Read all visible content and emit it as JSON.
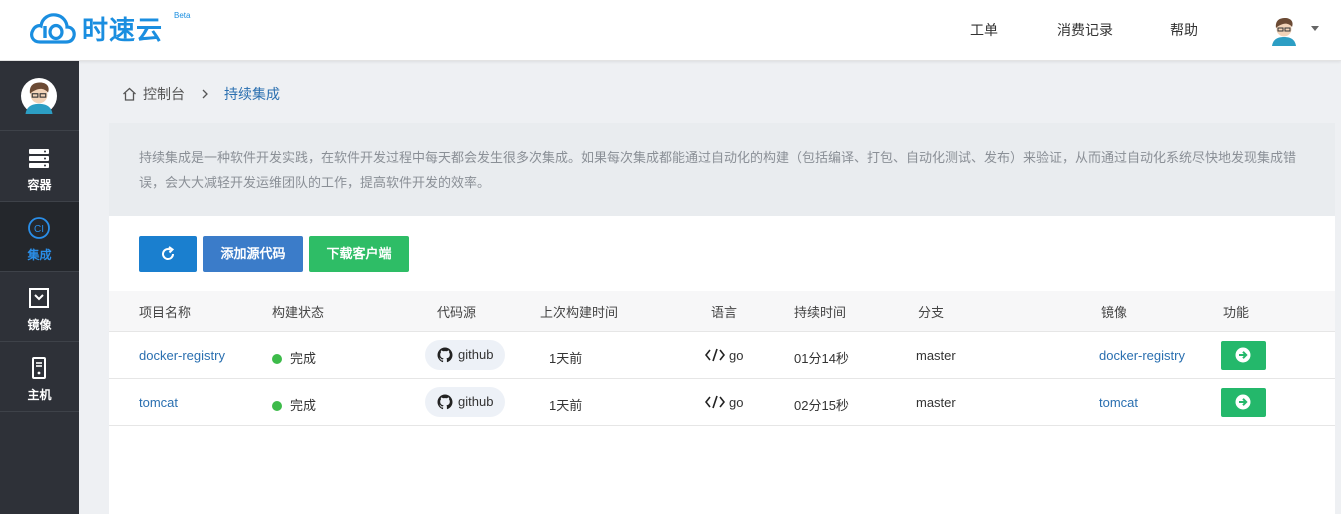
{
  "header": {
    "logo_text": "时速云",
    "logo_badge": "Beta",
    "nav": [
      "工单",
      "消费记录",
      "帮助"
    ]
  },
  "sidebar": {
    "items": [
      {
        "label": "容器",
        "icon": "server-icon"
      },
      {
        "label": "集成",
        "icon": "ci-icon",
        "active": true
      },
      {
        "label": "镜像",
        "icon": "image-box-icon"
      },
      {
        "label": "主机",
        "icon": "host-icon"
      }
    ]
  },
  "breadcrumb": {
    "home": "控制台",
    "current": "持续集成"
  },
  "description": "持续集成是一种软件开发实践，在软件开发过程中每天都会发生很多次集成。如果每次集成都能通过自动化的构建（包括编译、打包、自动化测试、发布）来验证，从而通过自动化系统尽快地发现集成错误，会大大减轻开发运维团队的工作，提高软件开发的效率。",
  "toolbar": {
    "add_source_label": "添加源代码",
    "download_client_label": "下载客户端"
  },
  "table": {
    "columns": [
      "项目名称",
      "构建状态",
      "代码源",
      "上次构建时间",
      "语言",
      "持续时间",
      "分支",
      "镜像",
      "功能"
    ],
    "rows": [
      {
        "name": "docker-registry",
        "status": "完成",
        "source": "github",
        "last_build": "1天前",
        "language": "go",
        "duration": "01分14秒",
        "branch": "master",
        "image": "docker-registry"
      },
      {
        "name": "tomcat",
        "status": "完成",
        "source": "github",
        "last_build": "1天前",
        "language": "go",
        "duration": "02分15秒",
        "branch": "master",
        "image": "tomcat"
      }
    ]
  },
  "colors": {
    "brand_blue": "#1a8ee0",
    "sidebar_bg": "#2e3138",
    "refresh_btn": "#1a7fcf",
    "add_btn": "#3b7cc9",
    "download_btn": "#2ebd66",
    "status_green": "#3dbb4a",
    "link": "#2a6fb0"
  }
}
